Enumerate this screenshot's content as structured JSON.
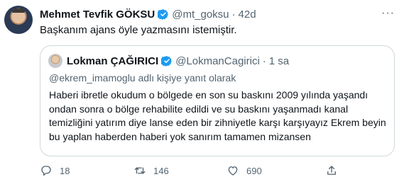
{
  "tweet": {
    "author_name": "Mehmet Tevfik GÖKSU",
    "author_handle": "@mt_goksu",
    "separator": "·",
    "time": "42d",
    "text": "Başkanım ajans öyle yazmasını istemiştir.",
    "more_icon": "more-dots-icon",
    "verified_color": "#1d9bf0"
  },
  "quoted": {
    "author_name": "Lokman ÇAĞIRICI",
    "author_handle": "@LokmanCagirici",
    "separator": "·",
    "time": "1 sa",
    "reply_to": "@ekrem_imamoglu adlı kişiye yanıt olarak",
    "text": "Haberi ibretle okudum o bölgede en son su baskını 2009 yılında yaşandı ondan sonra o bölge rehabilite edildi ve su baskını yaşanmadı kanal temizliğini yatırım diye lanse eden bir zihniyetle karşı karşıyayız Ekrem beyin bu yaplan haberden haberi yok sanırım tamamen mizansen"
  },
  "actions": {
    "reply_count": "18",
    "retweet_count": "146",
    "like_count": "690",
    "icons": [
      "reply-icon",
      "retweet-icon",
      "like-icon",
      "share-icon"
    ]
  }
}
